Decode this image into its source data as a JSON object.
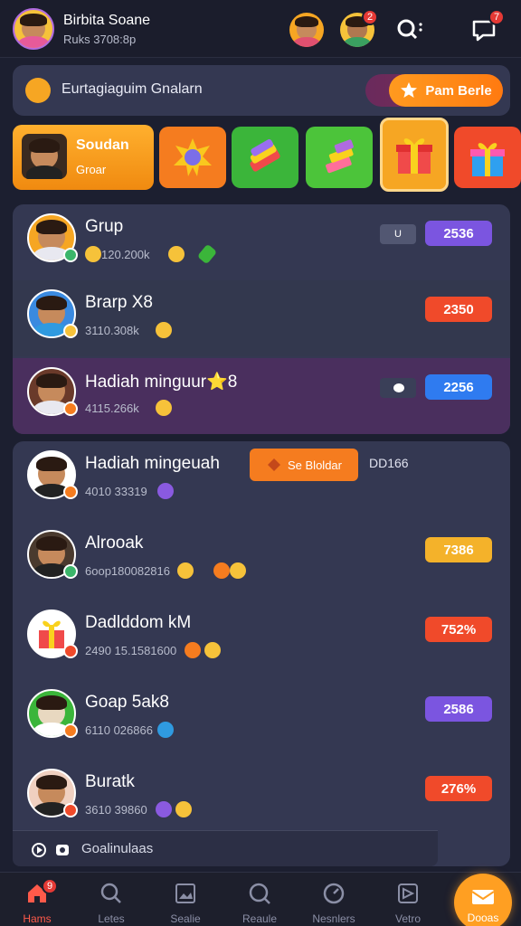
{
  "header": {
    "user_name": "Birbita Soane",
    "user_sub": "Ruks 3708:8p",
    "badge_friends": "2",
    "badge_chat": "7"
  },
  "banner": {
    "text": "Eurtagiaguim Gnalarn",
    "button_label": "Pam Berle"
  },
  "gift_row": {
    "first_title": "Soudan",
    "first_sub": "Groar"
  },
  "list_top": [
    {
      "name": "Grup",
      "sub": "120.200k",
      "value": "2536",
      "color": "#7b55e0",
      "tag": "U"
    },
    {
      "name": "Brarp X8",
      "sub": "3110.308k",
      "value": "2350",
      "color": "#f04a2a",
      "tag": ""
    },
    {
      "name": "Hadiah minguur⭐️8",
      "sub": "4115.266k",
      "value": "2256",
      "color": "#2f7bf0",
      "tag": ""
    }
  ],
  "list_bottom_head": {
    "name": "Hadiah mingeuah",
    "sub": "4010 33319",
    "see_label": "Se Bloldar",
    "code": "DD166"
  },
  "list_bottom": [
    {
      "name": "Alrooak",
      "sub": "6oop180082816",
      "value": "7386",
      "color": "#f4b22a"
    },
    {
      "name": "Dadlddom kM",
      "sub": "2490 15.1581600",
      "value": "752%",
      "color": "#f04a2a"
    },
    {
      "name": "Goap 5ak8",
      "sub": "6110 026866",
      "value": "2586",
      "color": "#7b55e0"
    },
    {
      "name": "Buratk",
      "sub": "3610 39860",
      "value": "276%",
      "color": "#f04a2a"
    }
  ],
  "footer_text": "Goalinulaas",
  "nav": [
    {
      "label": "Hams",
      "icon": "home-icon",
      "badge": "9"
    },
    {
      "label": "Letes",
      "icon": "search-icon"
    },
    {
      "label": "Sealie",
      "icon": "image-icon"
    },
    {
      "label": "Reaule",
      "icon": "magnifier-icon"
    },
    {
      "label": "Nesnlers",
      "icon": "gauge-icon"
    },
    {
      "label": "Vetro",
      "icon": "send-icon"
    },
    {
      "label": "Dooas",
      "icon": "mail-icon"
    }
  ]
}
